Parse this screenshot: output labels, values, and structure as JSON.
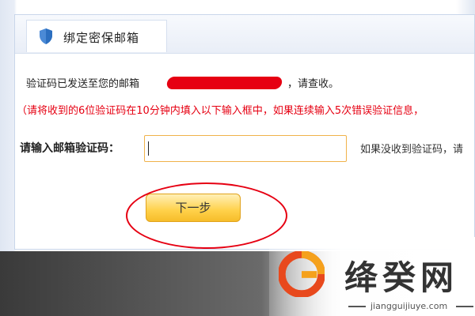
{
  "dialog": {
    "title": "绑定密保邮箱",
    "sent_prefix": "验证码已发送至您的邮箱",
    "sent_suffix": "，请查收。",
    "warning": "（请将收到的6位验证码在10分钟内填入以下输入框中，如果连续输入5次错误验证信息，",
    "code_label": "请输入邮箱验证码：",
    "code_value": "",
    "hint": "如果没收到验证码，请",
    "next_button": "下一步"
  },
  "watermark": {
    "name": "绛癸网",
    "url": "jiangguijiuye.com"
  },
  "colors": {
    "accent_red": "#e60012",
    "button_yellow": "#ffd14a",
    "input_border": "#f0b24a"
  },
  "icons": {
    "header": "shield-icon",
    "logo": "logo-g-icon"
  }
}
